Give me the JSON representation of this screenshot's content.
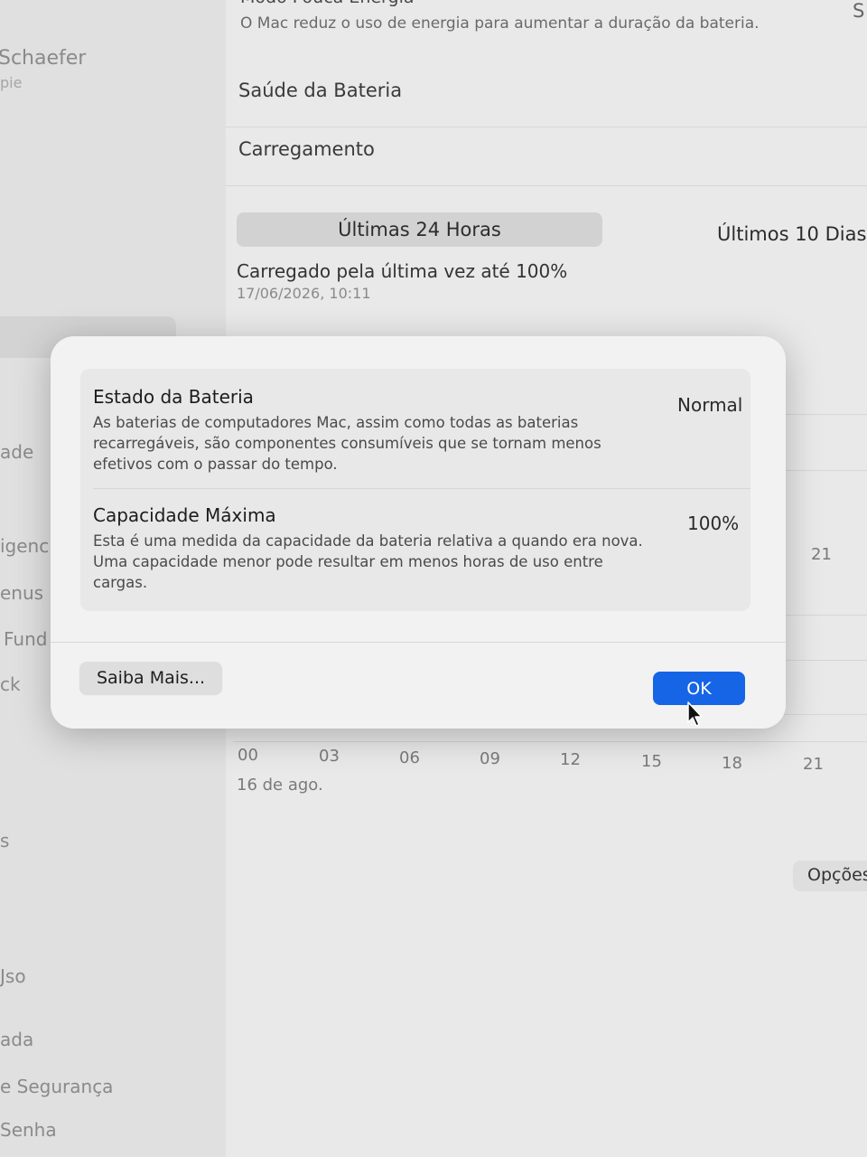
{
  "sidebar": {
    "user_name": "Schaefer",
    "user_sub": "pie",
    "items": [
      "ade",
      "igenc",
      "enus",
      "Fund",
      "ck",
      "s",
      "Jso",
      "ada",
      "e Segurança",
      "Senha"
    ]
  },
  "main": {
    "top_title": "Modo Pouca Energia",
    "top_desc": "O Mac reduz o uso de energia para aumentar a duração da bateria.",
    "corner": "S",
    "rows": [
      "Saúde da Bateria",
      "Carregamento"
    ],
    "segments": [
      "Últimas 24 Horas",
      "Últimos 10 Dias"
    ],
    "last_charged": "Carregado pela última vez até 100%",
    "last_charged_time": "17/06/2026, 10:11",
    "chart_right_label": "21",
    "x_ticks": [
      "00",
      "03",
      "06",
      "09",
      "12",
      "15",
      "18",
      "21"
    ],
    "date_label": "16 de ago.",
    "options_label": "Opções"
  },
  "dialog": {
    "state_title": "Estado da Bateria",
    "state_value": "Normal",
    "state_desc": "As baterias de computadores Mac, assim como todas as baterias recarregáveis, são componentes consumíveis que se tornam menos efetivos com o passar do tempo.",
    "capacity_title": "Capacidade Máxima",
    "capacity_value": "100%",
    "capacity_desc": "Esta é uma medida da capacidade da bateria relativa a quando era nova. Uma capacidade menor pode resultar em menos horas de uso entre cargas.",
    "more_button": "Saiba Mais...",
    "ok_button": "OK"
  },
  "colors": {
    "accent": "#1565e6"
  }
}
